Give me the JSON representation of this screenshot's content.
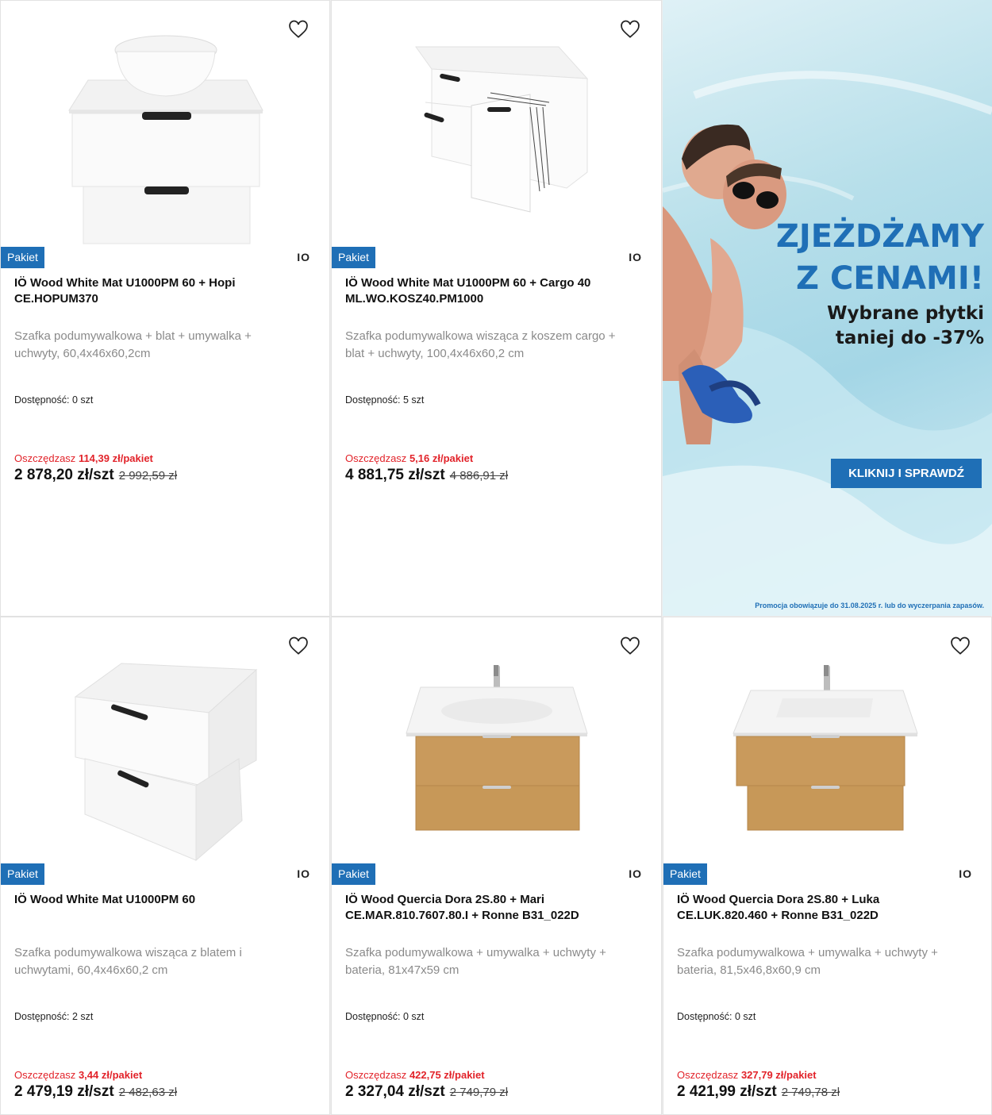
{
  "common": {
    "badge": "Pakiet",
    "brand": "IO",
    "availability_label": "Dostępność:",
    "save_label": "Oszczędzasz"
  },
  "banner": {
    "headline_1": "ZJEŻDŻAMY",
    "headline_2": "Z CENAMI!",
    "subline_1": "Wybrane płytki",
    "subline_2": "taniej do -37%",
    "cta": "KLIKNIJ I SPRAWDŹ",
    "legal": "Promocja obowiązuje do 31.08.2025 r. lub do wyczerpania zapasów.",
    "accent_color": "#1f6fb6"
  },
  "products": [
    {
      "title": "IÖ Wood White Mat U1000PM 60 + Hopi CE.HOPUM370",
      "description": "Szafka podumywalkowa + blat + umywalka + uchwyty, 60,4x46x60,2cm",
      "availability": "0 szt",
      "saving": "114,39 zł/pakiet",
      "price": "2 878,20 zł/szt",
      "old_price": "2 992,59 zł"
    },
    {
      "title": "IÖ Wood White Mat U1000PM 60 + Cargo 40 ML.WO.KOSZ40.PM1000",
      "description": "Szafka podumywalkowa wisząca z koszem cargo + blat + uchwyty, 100,4x46x60,2 cm",
      "availability": "5 szt",
      "saving": "5,16 zł/pakiet",
      "price": "4 881,75 zł/szt",
      "old_price": "4 886,91 zł"
    },
    {
      "title": "IÖ Wood White Mat U1000PM 60",
      "description": "Szafka podumywalkowa wisząca z blatem i uchwytami, 60,4x46x60,2 cm",
      "availability": "2 szt",
      "saving": "3,44 zł/pakiet",
      "price": "2 479,19 zł/szt",
      "old_price": "2 482,63 zł"
    },
    {
      "title": "IÖ Wood Quercia Dora 2S.80 + Mari CE.MAR.810.7607.80.I + Ronne B31_022D",
      "description": "Szafka podumywalkowa + umywalka + uchwyty + bateria, 81x47x59 cm",
      "availability": "0 szt",
      "saving": "422,75 zł/pakiet",
      "price": "2 327,04 zł/szt",
      "old_price": "2 749,79 zł"
    },
    {
      "title": "IÖ Wood Quercia Dora 2S.80 + Luka CE.LUK.820.460 + Ronne B31_022D",
      "description": "Szafka podumywalkowa + umywalka + uchwyty + bateria, 81,5x46,8x60,9 cm",
      "availability": "0 szt",
      "saving": "327,79 zł/pakiet",
      "price": "2 421,99 zł/szt",
      "old_price": "2 749,78 zł"
    }
  ]
}
